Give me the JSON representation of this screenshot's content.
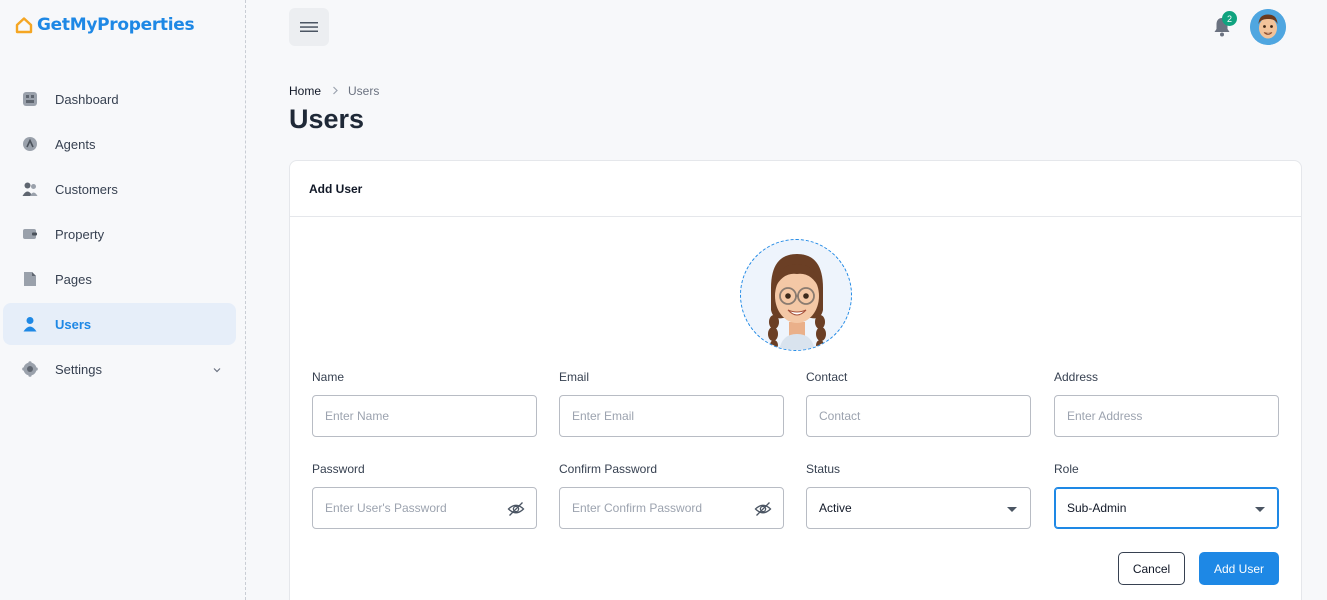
{
  "brand": {
    "name": "GetMyProperties",
    "accent": "#1e88e5",
    "logo_color": "#f5a623"
  },
  "sidebar": {
    "items": [
      {
        "label": "Dashboard",
        "icon": "dashboard-icon"
      },
      {
        "label": "Agents",
        "icon": "agent-icon"
      },
      {
        "label": "Customers",
        "icon": "customers-icon"
      },
      {
        "label": "Property",
        "icon": "property-icon"
      },
      {
        "label": "Pages",
        "icon": "pages-icon"
      },
      {
        "label": "Users",
        "icon": "user-icon",
        "active": true
      },
      {
        "label": "Settings",
        "icon": "settings-icon",
        "expandable": true
      }
    ]
  },
  "header": {
    "notification_count": "2"
  },
  "breadcrumb": {
    "home": "Home",
    "current": "Users"
  },
  "page": {
    "title": "Users"
  },
  "form": {
    "title": "Add User",
    "fields": {
      "name": {
        "label": "Name",
        "placeholder": "Enter Name"
      },
      "email": {
        "label": "Email",
        "placeholder": "Enter Email"
      },
      "contact": {
        "label": "Contact",
        "placeholder": "Contact"
      },
      "address": {
        "label": "Address",
        "placeholder": "Enter Address"
      },
      "password": {
        "label": "Password",
        "placeholder": "Enter User's Password"
      },
      "confirm_password": {
        "label": "Confirm Password",
        "placeholder": "Enter Confirm Password"
      },
      "status": {
        "label": "Status",
        "value": "Active"
      },
      "role": {
        "label": "Role",
        "value": "Sub-Admin"
      }
    },
    "cancel_label": "Cancel",
    "submit_label": "Add User"
  }
}
